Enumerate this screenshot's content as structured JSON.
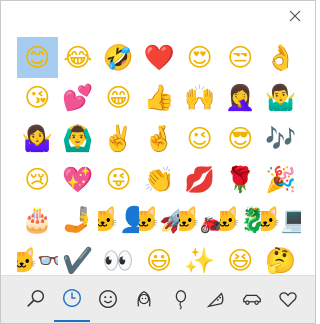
{
  "window": {
    "close_icon": "close-icon"
  },
  "emoji_grid": {
    "selected_index": 0,
    "rows": [
      [
        "😊",
        "😂",
        "🤣",
        "❤️",
        "😍",
        "😒",
        "👌"
      ],
      [
        "😘",
        "💕",
        "😁",
        "👍",
        "🙌",
        "🤦‍♀️",
        "🤷‍♂️"
      ],
      [
        "🤷‍♀️",
        "🙆‍♂️",
        "✌️",
        "🤞",
        "😉",
        "😎",
        "🎶"
      ],
      [
        "😢",
        "💖",
        "😜",
        "👏",
        "💋",
        "🌹",
        "🎉"
      ],
      [
        "🎂",
        "🤳",
        "🐱‍👤",
        "🐱‍🚀",
        "🐱‍🏍",
        "🐱‍🐉",
        "🐱‍💻"
      ],
      [
        "🐱‍👓",
        "✔️",
        "👀",
        "😃",
        "✨",
        "😆",
        "🤔"
      ]
    ]
  },
  "categories": [
    {
      "name": "search-icon",
      "active": false
    },
    {
      "name": "recently-used-clock-icon",
      "active": true
    },
    {
      "name": "smiley-face-icon",
      "active": false
    },
    {
      "name": "people-face-icon",
      "active": false
    },
    {
      "name": "balloon-celebration-icon",
      "active": false
    },
    {
      "name": "pizza-food-icon",
      "active": false
    },
    {
      "name": "car-transport-icon",
      "active": false
    },
    {
      "name": "heart-symbols-icon",
      "active": false
    }
  ],
  "colors": {
    "selection": "#a6cdf0",
    "accent": "#1f6fc5",
    "toolbar_bg": "#ececec"
  }
}
